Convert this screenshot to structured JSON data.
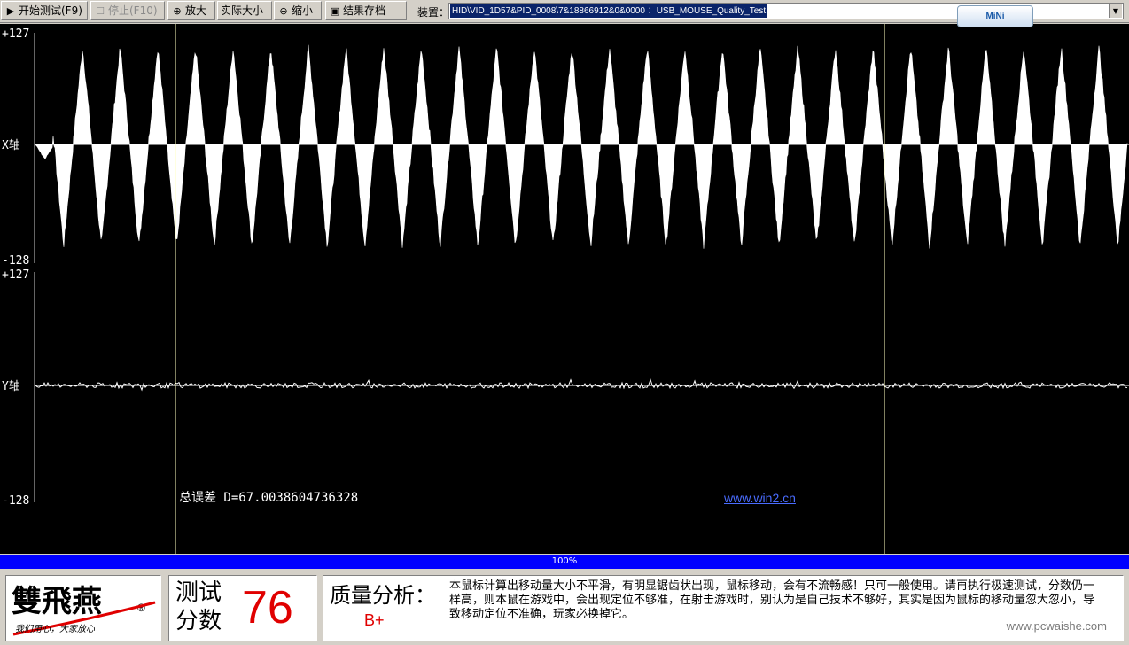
{
  "toolbar": {
    "start_label": "开始测试(F9)",
    "stop_label": "停止(F10)",
    "zoom_in_label": "放大",
    "actual_size_label": "实际大小",
    "zoom_out_label": "缩小",
    "save_label": "结果存档",
    "device_label": "装置：",
    "device_value": "HID\\VID_1D57&PID_0008\\7&18866912&0&0000 ：USB_MOUSE_Quality_Test",
    "mini_label": "MiNi"
  },
  "plot": {
    "x_axis": {
      "max_label": "+127",
      "min_label": "-128",
      "name": "X轴"
    },
    "y_axis": {
      "max_label": "+127",
      "min_label": "-128",
      "name": "Y轴"
    },
    "total_error": "总误差 D=67.0038604736328",
    "link": "www.win2.cn"
  },
  "chart_data": {
    "type": "area",
    "series": [
      {
        "name": "X轴",
        "ylim": [
          -128,
          127
        ],
        "peak_count": 29,
        "peak_value": 110,
        "trough_value": -115
      },
      {
        "name": "Y轴",
        "ylim": [
          -128,
          127
        ],
        "noise_amplitude": 6
      }
    ]
  },
  "progress": {
    "label": "100%",
    "value": 100
  },
  "brand": {
    "name": "雙飛燕",
    "slogan": "我们用心，大家放心"
  },
  "score": {
    "label": "测试分数",
    "value": "76"
  },
  "quality": {
    "label": "质量分析：",
    "grade": "B+",
    "text": "本鼠标计算出移动量大小不平滑，有明显锯齿状出现，鼠标移动，会有不流畅感！只可一般使用。请再执行极速测试，分数仍一样高，则本鼠在游戏中，会出现定位不够准，在射击游戏时，别认为是自己技术不够好，其实是因为鼠标的移动量忽大忽小，导致移动定位不准确，玩家必换掉它。"
  },
  "watermark": "www.pcwaishe.com",
  "colors": {
    "plot_bg": "#000000",
    "trace": "#ffffff",
    "marker_line": "#ffffc0",
    "progress": "#0000ff",
    "score": "#e00000",
    "link": "#4a6cff"
  }
}
